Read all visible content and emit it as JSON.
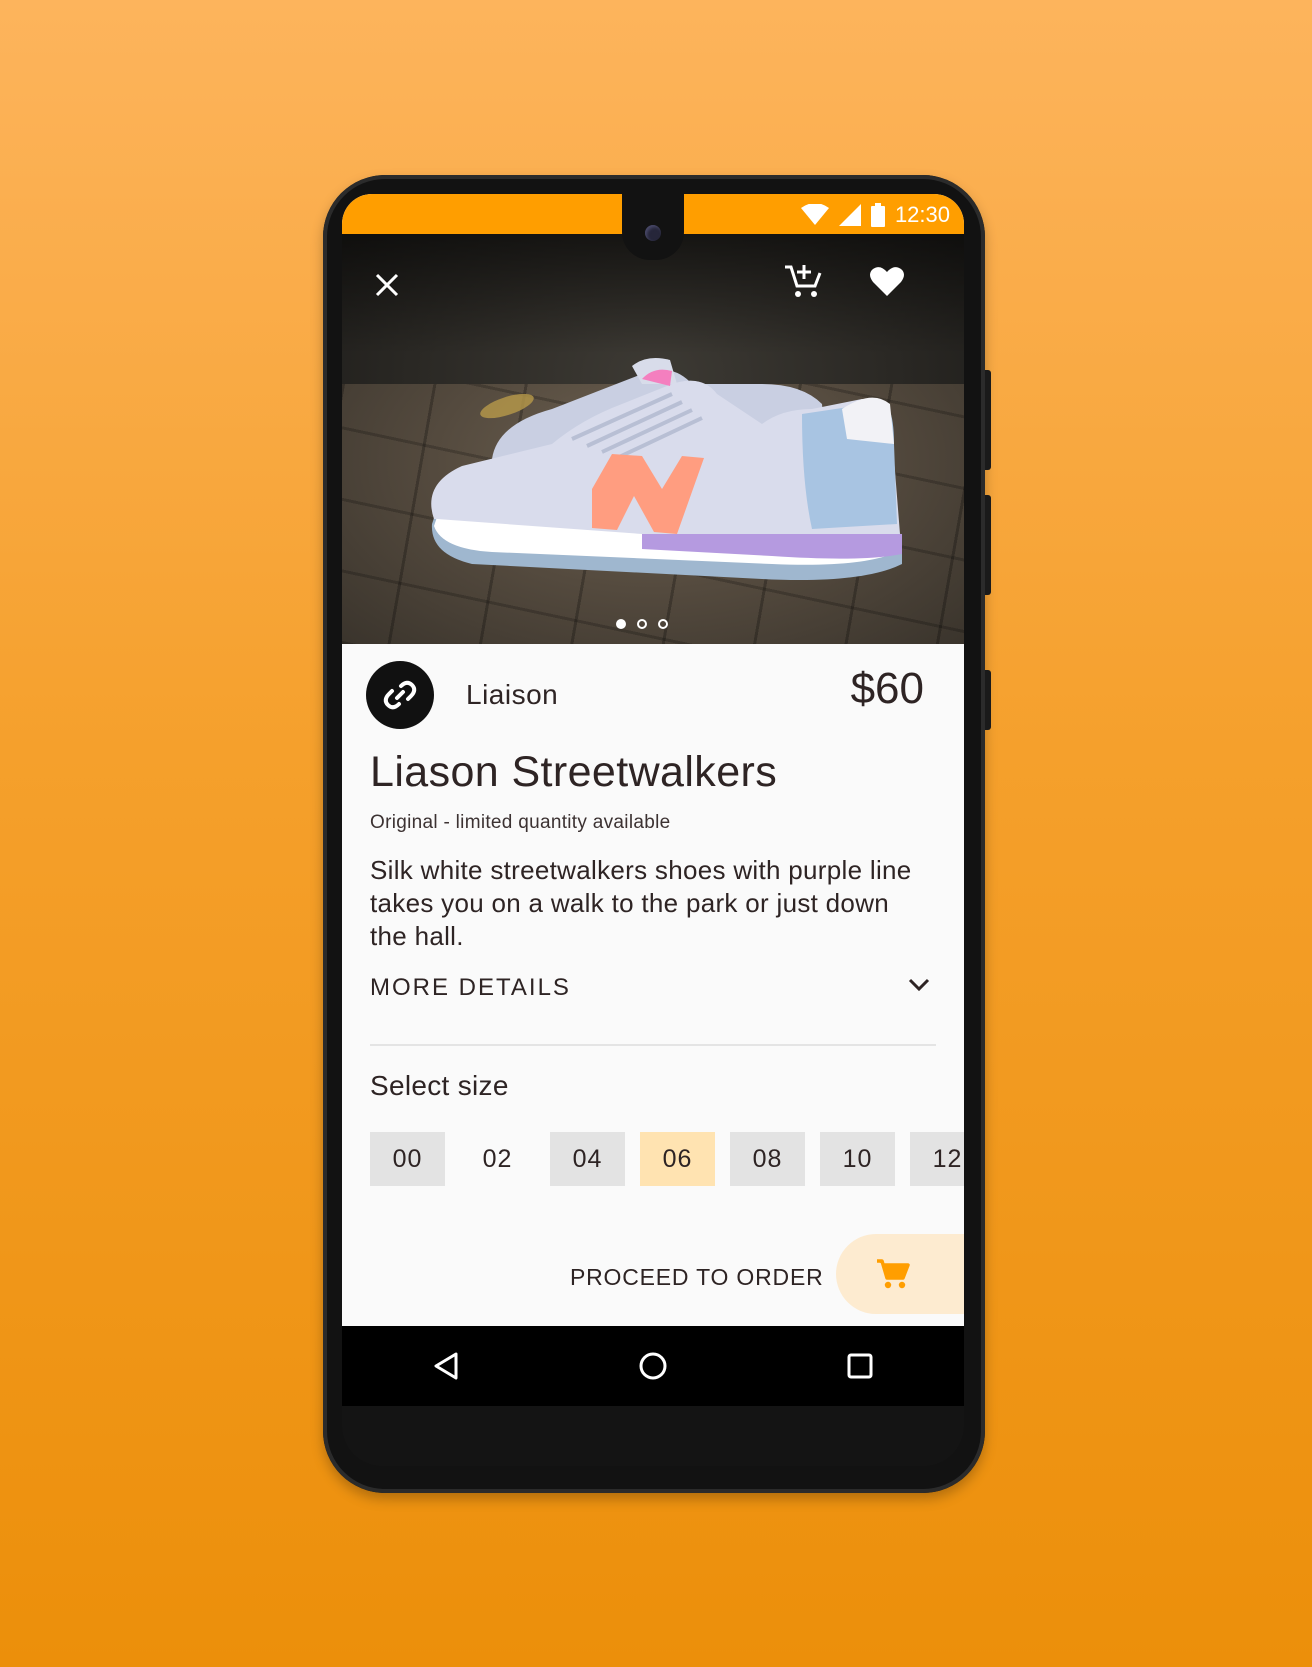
{
  "status_bar": {
    "time": "12:30"
  },
  "toolbar": {
    "close_icon": "close-icon",
    "add_cart_icon": "add-shopping-cart-icon",
    "favorite_icon": "heart-icon"
  },
  "gallery": {
    "page_count": 3,
    "active_index": 0
  },
  "product": {
    "brand": "Liaison",
    "price": "$60",
    "title": "Liason Streetwalkers",
    "subtitle": "Original - limited quantity available",
    "description": "Silk white streetwalkers shoes with purple line takes you on a walk to the park or just down the hall.",
    "more_details": "MORE DETAILS"
  },
  "size_picker": {
    "label": "Select size",
    "sizes": [
      "00",
      "02",
      "04",
      "06",
      "08",
      "10",
      "12"
    ],
    "selected": "06",
    "unavailable": [
      "02"
    ]
  },
  "order": {
    "proceed_label": "PROCEED TO ORDER",
    "cart_icon": "shopping-cart-icon"
  },
  "colors": {
    "accent": "#ff9e00",
    "selected_size_bg": "#ffe3b1",
    "text": "#2e2424",
    "cart_fab_bg": "#fdebd0"
  }
}
